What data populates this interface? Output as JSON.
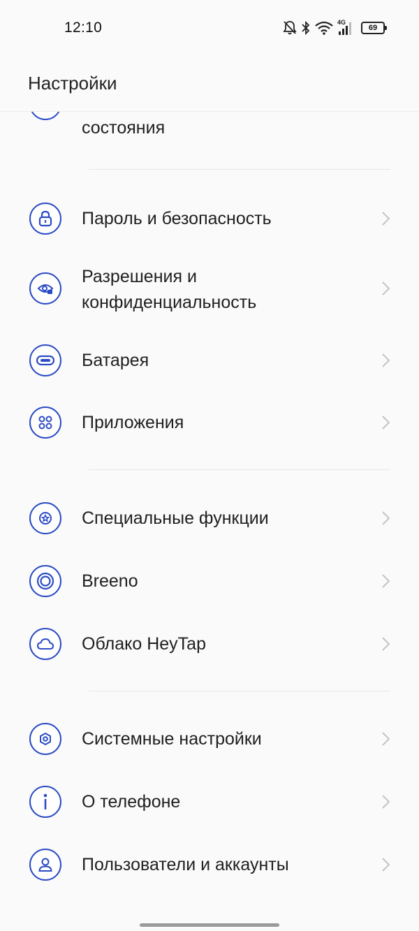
{
  "status_bar": {
    "time": "12:10",
    "network": "4G",
    "battery": "69",
    "icons": [
      "bell-off-icon",
      "bluetooth-icon",
      "wifi-icon",
      "cellular-signal-icon",
      "battery-icon"
    ]
  },
  "header": {
    "title": "Настройки"
  },
  "accent_color": "#2b4bc4",
  "items": [
    {
      "label": "состояния",
      "icon": "status-bar-icon"
    },
    {
      "label": "Пароль и безопасность",
      "icon": "lock-icon"
    },
    {
      "label_line1": "Разрешения и",
      "label_line2": "конфиденциальность",
      "icon": "privacy-eye-icon"
    },
    {
      "label": "Батарея",
      "icon": "battery-outline-icon"
    },
    {
      "label": "Приложения",
      "icon": "apps-grid-icon"
    },
    {
      "label": "Специальные функции",
      "icon": "star-icon"
    },
    {
      "label": "Breeno",
      "icon": "breeno-ring-icon"
    },
    {
      "label": "Облако HeyTap",
      "icon": "cloud-icon"
    },
    {
      "label": "Системные настройки",
      "icon": "hexagon-gear-icon"
    },
    {
      "label": "О телефоне",
      "icon": "info-icon"
    },
    {
      "label": "Пользователи и аккаунты",
      "icon": "user-icon"
    }
  ]
}
